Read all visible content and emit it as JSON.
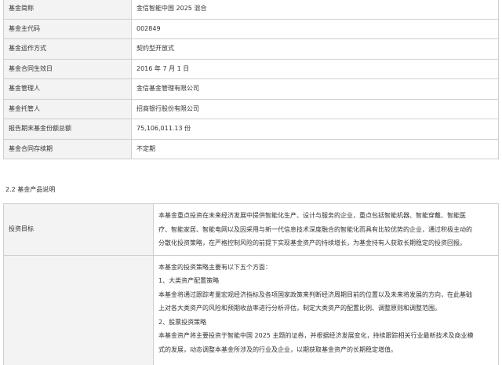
{
  "basic_info_table": [
    {
      "label": "基金简称",
      "value": "金信智能中国 2025 混合"
    },
    {
      "label": "基金主代码",
      "value": "002849"
    },
    {
      "label": "基金运作方式",
      "value": "契约型开放式"
    },
    {
      "label": "基金合同生效日",
      "value": "2016 年 7 月 1 日"
    },
    {
      "label": "基金管理人",
      "value": "金信基金管理有限公司"
    },
    {
      "label": "基金托管人",
      "value": "招商银行股份有限公司"
    },
    {
      "label": "报告期末基金份额总额",
      "value": "75,106,011.13 份"
    },
    {
      "label": "基金合同存续期",
      "value": "不定期"
    }
  ],
  "section_heading": "2.2 基金产品说明",
  "product_table": {
    "objective": {
      "label": "投资目标",
      "lines": [
        "本基金重点投资在未来经济发展中提供智能化生产、设计与服务的企业，重点包括智能机器、智能穿戴、智能医",
        "疗、智能家居、智能电网以及因采用与新一代信息技术深度融合的智能化而具有比较优势的企业，通过积极主动的",
        "分散化投资策略，在严格控制风险的前提下实现基金资产的持续增长，为基金持有人获取长期稳定的投资回报。"
      ]
    },
    "strategy": {
      "label": "",
      "lines": [
        "本基金的投资策略主要有以下五个方面：",
        "1、大类资产配置策略",
        "本基金将通过跟踪考量宏观经济指标及各项国家政策来判断经济周期目前的位置以及未来将发展的方向，在此基础",
        "上对各大类资产的风险和预期收益率进行分析评估，制定大类资产的配置比例、调整原则和调整范围。",
        "2、股票投资策略",
        "本基金资产将主要投资于智能中国 2025 主题的证券，并根据经济发展变化，持续跟踪相关行业最新技术及商业模",
        "式的发展，动态调整本基金所涉及的行业及企业，以期获取基金资产的长期稳定增值。"
      ]
    }
  }
}
